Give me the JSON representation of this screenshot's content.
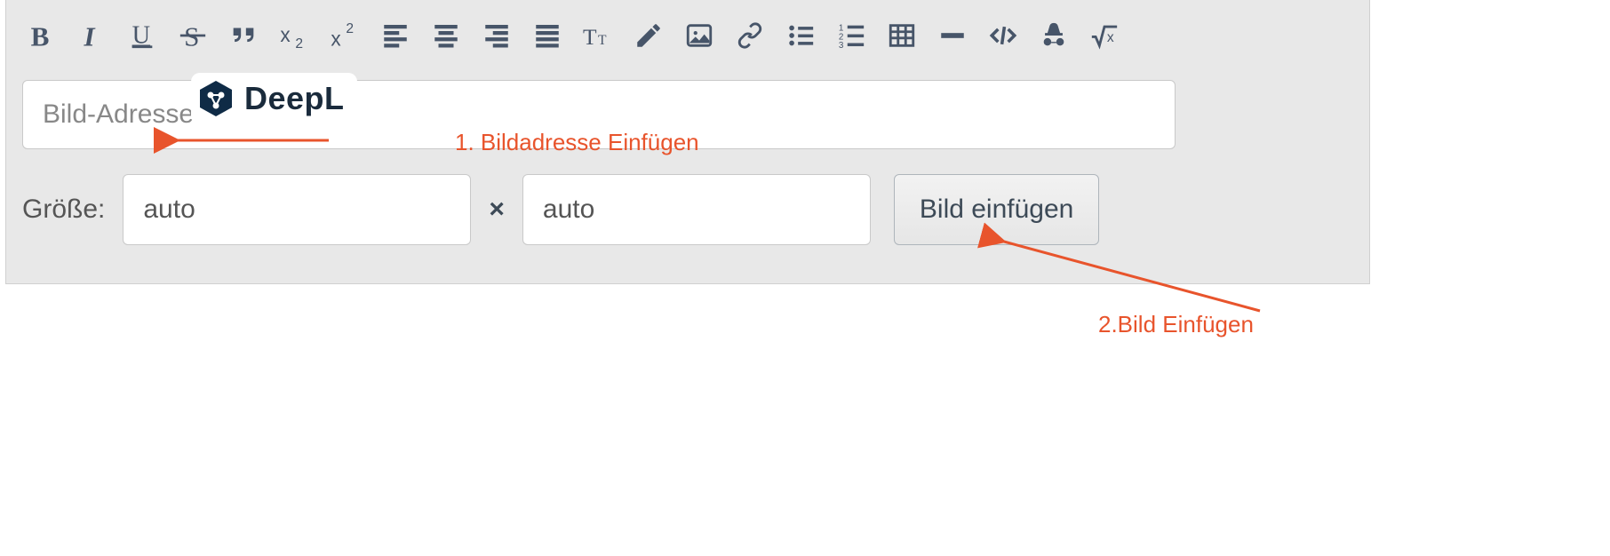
{
  "toolbar": {
    "icons": [
      "bold-icon",
      "italic-icon",
      "underline-icon",
      "strikethrough-icon",
      "quote-icon",
      "subscript-icon",
      "superscript-icon",
      "align-left-icon",
      "align-center-icon",
      "align-right-icon",
      "align-justify-icon",
      "text-size-icon",
      "pencil-icon",
      "image-icon",
      "link-icon",
      "bulleted-list-icon",
      "numbered-list-icon",
      "table-icon",
      "minus-icon",
      "code-icon",
      "anonymous-icon",
      "sqrt-icon"
    ]
  },
  "image_form": {
    "url_placeholder": "Bild-Adresse",
    "size_label": "Größe:",
    "width_placeholder": "auto",
    "height_placeholder": "auto",
    "times_symbol": "×",
    "insert_button": "Bild einfügen"
  },
  "deepl": {
    "label": "DeepL"
  },
  "annotations": {
    "step1": "1. Bildadresse Einfügen",
    "step2": "2.Bild Einfügen"
  }
}
